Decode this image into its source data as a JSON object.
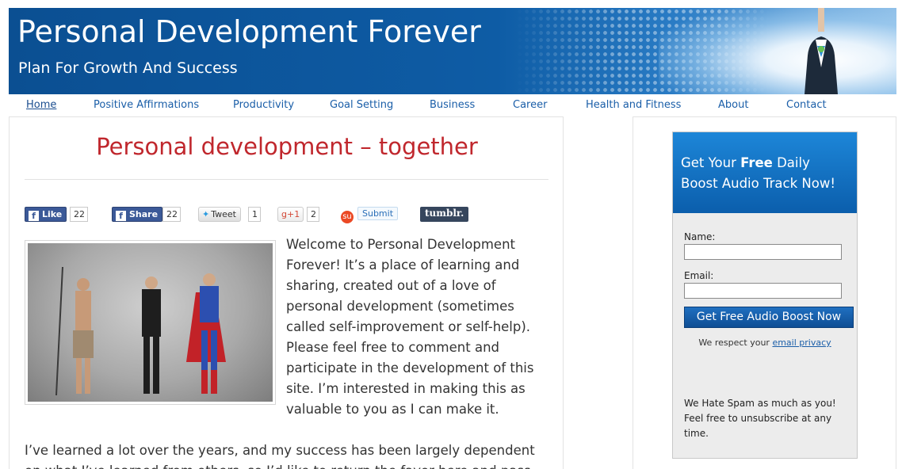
{
  "header": {
    "title": "Personal Development Forever",
    "tagline": "Plan For Growth And Success"
  },
  "nav": {
    "items": [
      {
        "label": "Home",
        "active": true
      },
      {
        "label": "Positive Affirmations"
      },
      {
        "label": "Productivity"
      },
      {
        "label": "Goal Setting"
      },
      {
        "label": "Business"
      },
      {
        "label": "Career"
      },
      {
        "label": "Health and Fitness"
      },
      {
        "label": "About"
      },
      {
        "label": "Contact"
      }
    ]
  },
  "post": {
    "title": "Personal development – together",
    "intro": "Welcome to Personal Development Forever! It’s a place of learning and sharing, created out of a love of personal development (sometimes called self-improvement or self-help). Please feel free to comment and participate in the development of this site. I’m interested in making this as valuable to you as I can make it.",
    "paragraph2": "I’ve learned a lot over the years, and my success has been largely dependent on what I’ve learned from others, so I’d like to return the favor here and pass"
  },
  "share": {
    "like_label": "Like",
    "like_count": "22",
    "share_label": "Share",
    "share_count": "22",
    "tweet_label": "Tweet",
    "tweet_count": "1",
    "gplus_label": "+1",
    "gplus_count": "2",
    "submit_label": "Submit",
    "tumblr_label": "tumblr."
  },
  "optin": {
    "heading_pre": "Get Your ",
    "heading_bold": "Free",
    "heading_post": " Daily Boost Audio Track Now!",
    "name_label": "Name:",
    "email_label": "Email:",
    "button_label": "Get Free Audio Boost Now",
    "respect_text": "We respect your ",
    "privacy_link": "email privacy",
    "spam_text": "We Hate Spam as much as you! Feel free to unsubscribe at any time."
  },
  "colors": {
    "header_blue": "#0b4f92",
    "title_red": "#c0272d",
    "link_blue": "#1a5ea8",
    "optin_blue": "#0b5eac"
  }
}
